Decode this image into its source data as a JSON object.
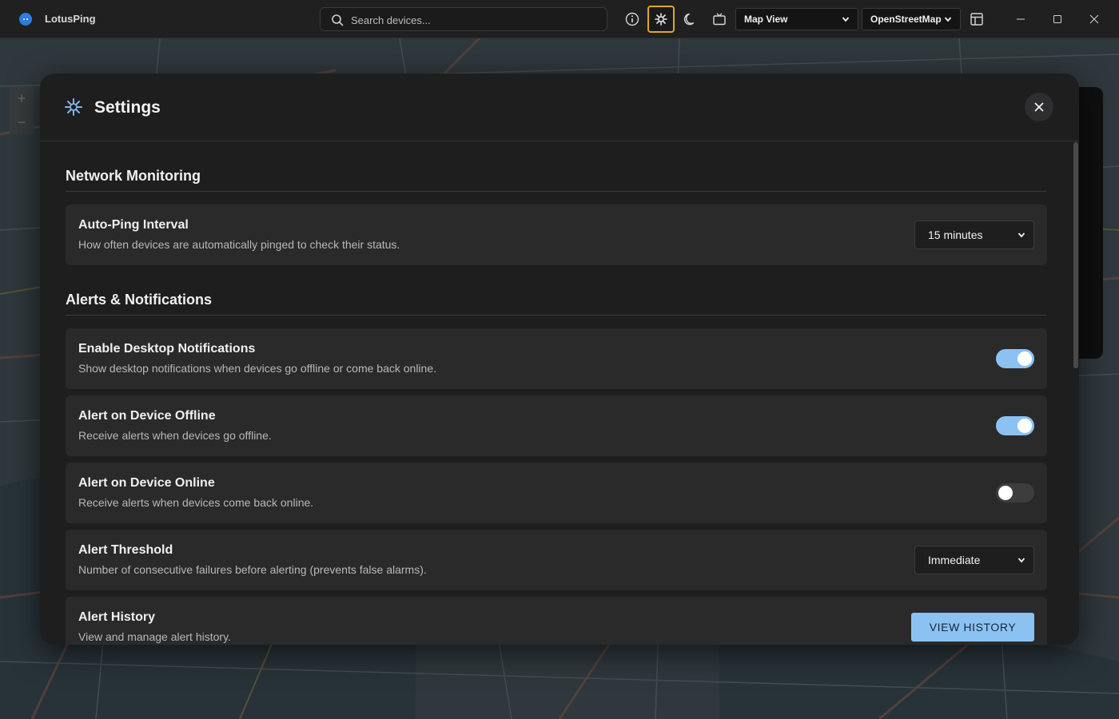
{
  "app": {
    "title": "LotusPing"
  },
  "search": {
    "placeholder": "Search devices..."
  },
  "toolbar": {
    "view_select": "Map View",
    "tile_select": "OpenStreetMap"
  },
  "modal": {
    "title": "Settings",
    "sections": [
      {
        "title": "Network Monitoring",
        "items": [
          {
            "title": "Auto-Ping Interval",
            "desc": "How often devices are automatically pinged to check their status.",
            "control": "select",
            "value": "15 minutes"
          }
        ]
      },
      {
        "title": "Alerts & Notifications",
        "items": [
          {
            "title": "Enable Desktop Notifications",
            "desc": "Show desktop notifications when devices go offline or come back online.",
            "control": "toggle",
            "value": true
          },
          {
            "title": "Alert on Device Offline",
            "desc": "Receive alerts when devices go offline.",
            "control": "toggle",
            "value": true
          },
          {
            "title": "Alert on Device Online",
            "desc": "Receive alerts when devices come back online.",
            "control": "toggle",
            "value": false
          },
          {
            "title": "Alert Threshold",
            "desc": "Number of consecutive failures before alerting (prevents false alarms).",
            "control": "select",
            "value": "Immediate"
          },
          {
            "title": "Alert History",
            "desc": "View and manage alert history.",
            "control": "button",
            "value": "VIEW HISTORY"
          }
        ]
      }
    ]
  },
  "colors": {
    "accent": "#8cc2f2",
    "active_outline": "#e2a81c",
    "gear": "#7fb6ec"
  }
}
